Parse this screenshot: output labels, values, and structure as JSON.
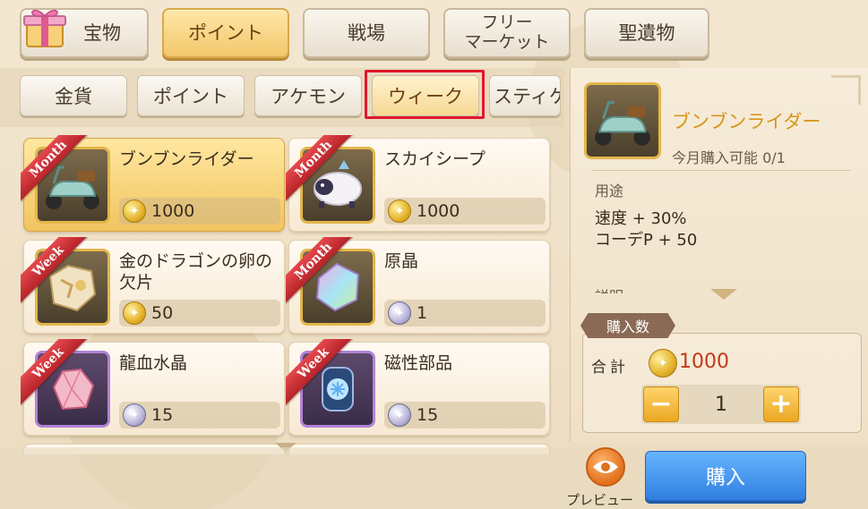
{
  "top_tabs": [
    {
      "label": "宝物"
    },
    {
      "label": "ポイント"
    },
    {
      "label": "戦場"
    },
    {
      "label": "フリー\nマーケット"
    },
    {
      "label": "聖遺物"
    }
  ],
  "sub_tabs": [
    {
      "label": "金貨"
    },
    {
      "label": "ポイント"
    },
    {
      "label": "アケモン"
    },
    {
      "label": "ウィーク"
    },
    {
      "label": "スティケ"
    }
  ],
  "items": [
    {
      "name": "ブンブンライダー",
      "ribbon": "Month",
      "price": "1000",
      "currency": "gold",
      "icon": "scooter-icon"
    },
    {
      "name": "スカイシープ",
      "ribbon": "Month",
      "price": "1000",
      "currency": "gold",
      "icon": "sheep-icon"
    },
    {
      "name": "金のドラゴンの卵の欠片",
      "ribbon": "Week",
      "price": "50",
      "currency": "gold",
      "icon": "egg-shard-icon"
    },
    {
      "name": "原晶",
      "ribbon": "Month",
      "price": "1",
      "currency": "silver",
      "icon": "crystal-icon"
    },
    {
      "name": "龍血水晶",
      "ribbon": "Week",
      "price": "15",
      "currency": "silver",
      "icon": "red-crystal-icon"
    },
    {
      "name": "磁性部品",
      "ribbon": "Week",
      "price": "15",
      "currency": "silver",
      "icon": "magnetic-part-icon"
    }
  ],
  "detail": {
    "title": "ブンブンライダー",
    "limit": "今月購入可能 0/1",
    "usage_label": "用途",
    "effects": [
      "速度 + 30%",
      "コーデP + 50"
    ],
    "description_label": "説明"
  },
  "purchase": {
    "qty_label": "購入数",
    "total_label": "合計",
    "total_value": "1000",
    "quantity": "1",
    "buy_label": "購入",
    "preview_label": "プレビュー"
  },
  "colors": {
    "accent_gold": "#f2c76a",
    "highlight_red": "#e0182c",
    "buy_blue": "#2f7fe0",
    "total_red": "#c0391b"
  }
}
